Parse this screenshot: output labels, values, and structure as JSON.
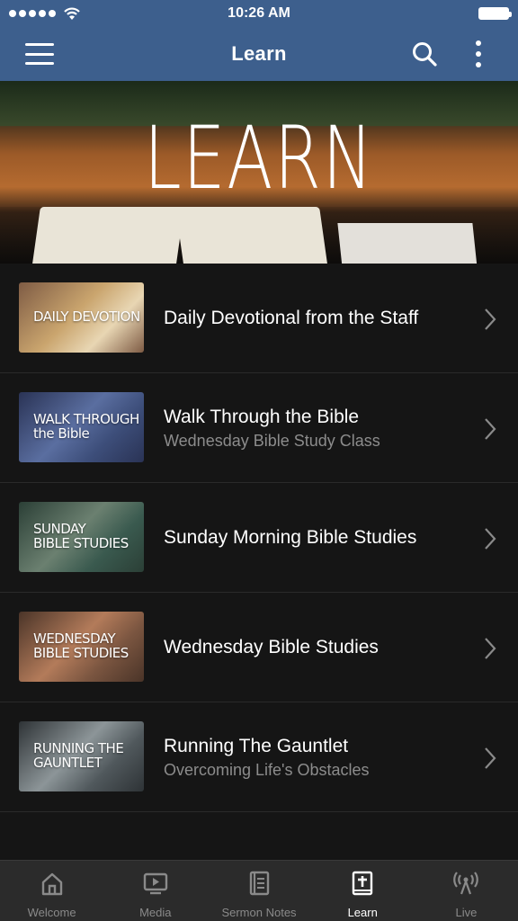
{
  "status_bar": {
    "time": "10:26 AM",
    "signal_dots": 5,
    "battery_level": 1.0
  },
  "nav": {
    "title": "Learn",
    "menu_icon": "hamburger-menu-icon",
    "search_icon": "search-icon",
    "more_icon": "more-vertical-icon"
  },
  "hero": {
    "title": "LEARN"
  },
  "items": [
    {
      "thumb_lines": [
        "DAILY DEVOTION"
      ],
      "thumb_colors": [
        "#e8d6b3",
        "#caa56e",
        "#7e5b44"
      ],
      "title": "Daily Devotional from the Staff",
      "subtitle": ""
    },
    {
      "thumb_lines": [
        "WALK THROUGH",
        "the Bible"
      ],
      "thumb_colors": [
        "#3d4e7a",
        "#5a6ea0",
        "#2a3355"
      ],
      "title": "Walk Through the Bible",
      "subtitle": "Wednesday Bible Study Class"
    },
    {
      "thumb_lines": [
        "SUNDAY",
        "BIBLE STUDIES"
      ],
      "thumb_colors": [
        "#3a5a4f",
        "#6b8070",
        "#2b3f36"
      ],
      "title": "Sunday Morning Bible Studies",
      "subtitle": ""
    },
    {
      "thumb_lines": [
        "WEDNESDAY",
        "BIBLE STUDIES"
      ],
      "thumb_colors": [
        "#7a5540",
        "#b37b5a",
        "#4a3428"
      ],
      "title": "Wednesday Bible Studies",
      "subtitle": ""
    },
    {
      "thumb_lines": [
        "RUNNING THE",
        "GAUNTLET"
      ],
      "thumb_colors": [
        "#50585c",
        "#8c9598",
        "#2e3336"
      ],
      "title": "Running The Gauntlet",
      "subtitle": "Overcoming Life's Obstacles"
    }
  ],
  "tabs": [
    {
      "label": "Welcome",
      "icon": "home-icon",
      "active": false
    },
    {
      "label": "Media",
      "icon": "media-play-icon",
      "active": false
    },
    {
      "label": "Sermon Notes",
      "icon": "notebook-icon",
      "active": false
    },
    {
      "label": "Learn",
      "icon": "bible-icon",
      "active": true
    },
    {
      "label": "Live",
      "icon": "broadcast-icon",
      "active": false
    }
  ],
  "colors": {
    "nav_background": "#3d5f8d",
    "list_background": "#151515",
    "tab_bar_background": "#2b2b2b",
    "subtitle_text": "#8c8c8c",
    "tab_inactive": "#8a8a8a",
    "tab_active": "#ffffff"
  }
}
